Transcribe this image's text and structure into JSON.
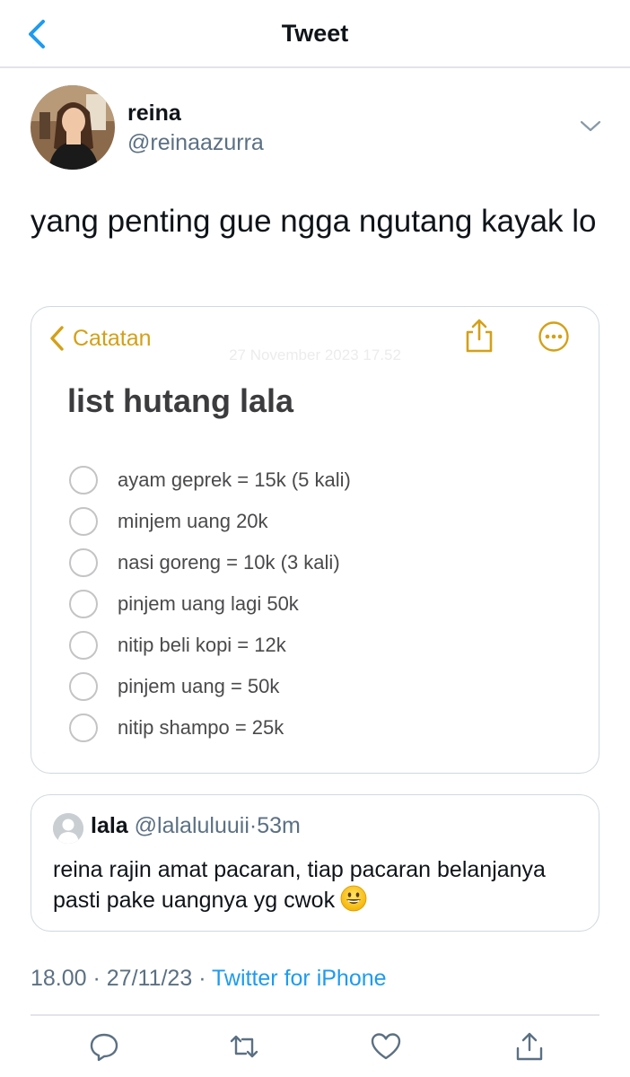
{
  "header": {
    "title": "Tweet"
  },
  "tweet": {
    "author_name": "reina",
    "author_handle": "@reinaazurra",
    "text": "yang penting gue ngga ngutang kayak lo",
    "time": "18.00",
    "date": "27/11/23",
    "source": "Twitter for iPhone",
    "separator": " · "
  },
  "notes": {
    "back_label": "Catatan",
    "date": "27 November 2023 17.52",
    "title": "list hutang lala",
    "accent_color": "#d4a017",
    "items": [
      {
        "label": "ayam geprek = 15k (5 kali)",
        "checked": false
      },
      {
        "label": "minjem uang 20k",
        "checked": false
      },
      {
        "label": "nasi goreng = 10k (3 kali)",
        "checked": false
      },
      {
        "label": "pinjem uang lagi 50k",
        "checked": false
      },
      {
        "label": "nitip beli kopi = 12k",
        "checked": false
      },
      {
        "label": "pinjem uang = 50k",
        "checked": false
      },
      {
        "label": "nitip shampo = 25k",
        "checked": false
      }
    ]
  },
  "quote": {
    "name": "lala",
    "handle": "@lalaluluuii",
    "time": "53m",
    "separator": "·",
    "text": "reina rajin amat pacaran, tiap pacaran belanjanya pasti pake uangnya yg cwok",
    "emoji": "grinning-face"
  },
  "actions": [
    "reply-icon",
    "retweet-icon",
    "like-icon",
    "share-icon"
  ],
  "colors": {
    "link": "#1d9bf0",
    "secondary": "#5b7083",
    "text": "#0f1419"
  }
}
